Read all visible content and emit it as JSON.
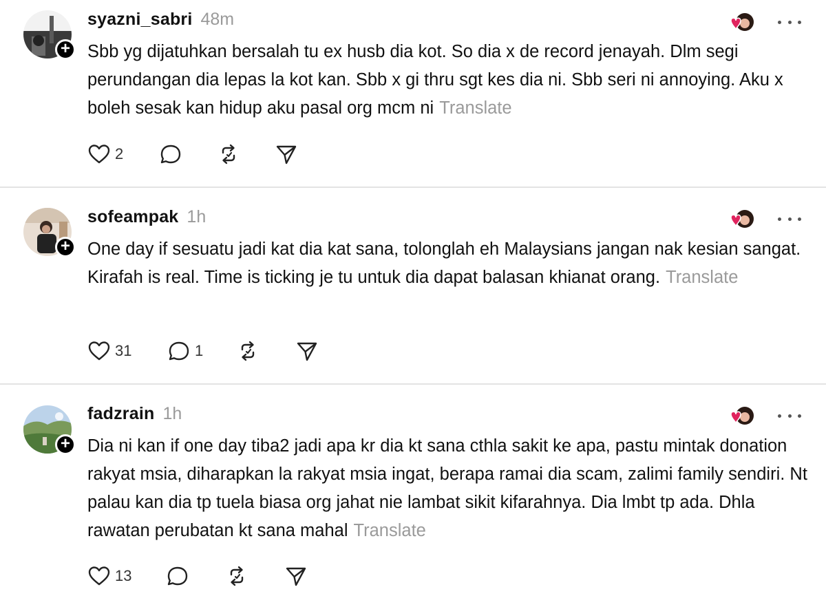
{
  "posts": [
    {
      "username": "syazni_sabri",
      "time": "48m",
      "text": "Sbb yg dijatuhkan bersalah tu ex husb dia kot. So dia x de record jenayah. Dlm segi perundangan dia lepas la kot kan. Sbb x gi thru sgt kes dia ni. Sbb seri ni annoying. Aku x boleh sesak kan hidup aku pasal org mcm ni",
      "translate": "Translate",
      "likes": "2",
      "replies": ""
    },
    {
      "username": "sofeampak",
      "time": "1h",
      "text": "One day if sesuatu jadi kat dia kat sana, tolonglah eh Malaysians jangan nak kesian sangat. Kirafah is real. Time is ticking je tu untuk dia dapat balasan khianat orang.",
      "translate": "Translate",
      "likes": "31",
      "replies": "1"
    },
    {
      "username": "fadzrain",
      "time": "1h",
      "text": "Dia ni kan if one day tiba2 jadi apa kr dia kt sana cthla sakit ke apa, pastu mintak donation rakyat msia, diharapkan la rakyat msia ingat, berapa ramai dia scam, zalimi family sendiri. Nt palau kan dia tp tuela biasa org jahat nie lambat sikit kifarahnya. Dia lmbt tp ada. Dhla rawatan perubatan kt sana mahal",
      "translate": "Translate",
      "likes": "13",
      "replies": ""
    }
  ],
  "icons": {
    "like": "heart-icon",
    "reply": "comment-icon",
    "repost": "repost-icon",
    "share": "share-icon",
    "follow": "plus-icon",
    "more": "more-icon"
  },
  "colors": {
    "heart_red": "#e0245e",
    "muted_text": "#9a9a9a",
    "divider": "#e3e3e3"
  }
}
